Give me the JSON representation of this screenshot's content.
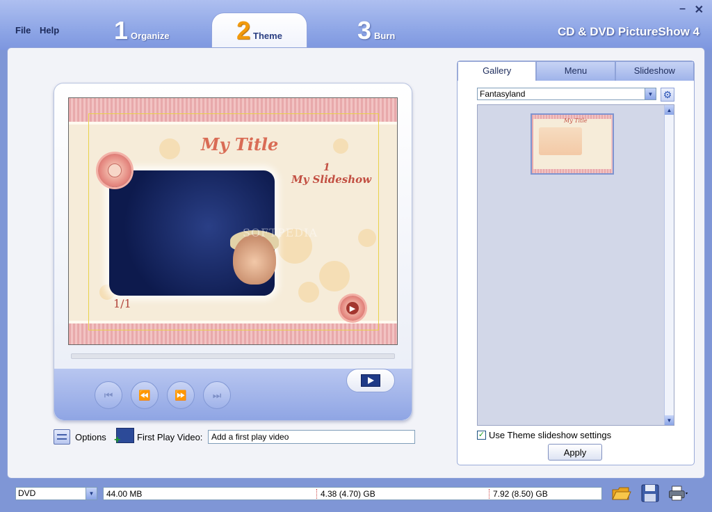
{
  "app_title": "CD & DVD PictureShow 4",
  "menu": {
    "file": "File",
    "help": "Help"
  },
  "steps": [
    {
      "num": "1",
      "label": "Organize"
    },
    {
      "num": "2",
      "label": "Theme"
    },
    {
      "num": "3",
      "label": "Burn"
    }
  ],
  "window_controls": {
    "minimize": "–",
    "close": "✕"
  },
  "preview": {
    "title": "My Title",
    "slide_number": "1",
    "slide_name": "My Slideshow",
    "page_counter": "1/1"
  },
  "options": {
    "label": "Options",
    "first_play_label": "First Play Video:",
    "first_play_value": "Add a first play video"
  },
  "gallery": {
    "tabs": [
      "Gallery",
      "Menu",
      "Slideshow"
    ],
    "selected_theme": "Fantasyland",
    "thumb_title": "My Title",
    "use_theme_label": "Use Theme slideshow settings",
    "use_theme_checked": true,
    "apply_label": "Apply"
  },
  "status": {
    "disc_type": "DVD",
    "used": "44.00 MB",
    "mark1": "4.38 (4.70) GB",
    "mark2": "7.92 (8.50) GB"
  },
  "icons": {
    "open": "folder-icon",
    "save": "floppy-disk-icon",
    "print": "printer-icon",
    "settings": "gear-icon",
    "options": "options-list-icon",
    "first_play": "film-add-icon"
  }
}
